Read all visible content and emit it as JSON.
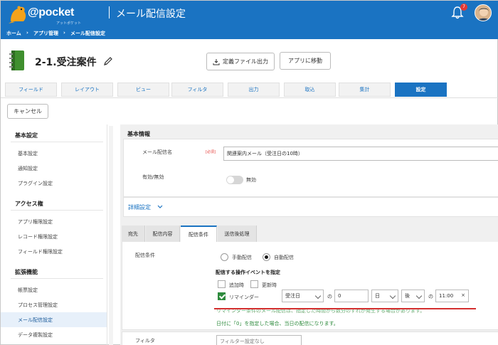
{
  "header": {
    "brand": "@pocket",
    "brand_sub": "アットポケット",
    "page_title": "メール配信設定",
    "notification_count": "7"
  },
  "breadcrumb": [
    "ホーム",
    "›",
    "アプリ管理",
    "›",
    "メール配信設定"
  ],
  "app": {
    "title": "2-1.受注案件",
    "export_button": "定義ファイル出力",
    "goto_app_button": "アプリに移動"
  },
  "tabs": [
    "フィールド",
    "レイアウト",
    "ビュー",
    "フィルタ",
    "出力",
    "取込",
    "集計",
    "設定"
  ],
  "active_tab": "設定",
  "cancel_button": "キャンセル",
  "sidebar": {
    "sections": [
      {
        "heading": "基本設定",
        "items": [
          "基本設定",
          "通知設定",
          "プラグイン設定"
        ]
      },
      {
        "heading": "アクセス権",
        "items": [
          "アプリ権限設定",
          "レコード権限設定",
          "フィールド権限設定"
        ]
      },
      {
        "heading": "拡張機能",
        "items": [
          "帳票設定",
          "プロセス管理設定",
          "メール配信設定",
          "データ複製設定"
        ]
      }
    ],
    "active_item": "メール配信設定"
  },
  "basic_info": {
    "heading": "基本情報",
    "name_label": "メール配信名",
    "required_badge": "[必須]",
    "name_value": "関連案内メール（受注日の10時）",
    "enabled_label": "有効/無効",
    "enabled_state": "無効"
  },
  "detail_settings_link": "詳細設定",
  "subtabs": [
    "宛先",
    "配信内容",
    "配信条件",
    "送信後処理"
  ],
  "active_subtab": "配信条件",
  "conditions": {
    "label": "配信条件",
    "manual_option": "手動配信",
    "auto_option": "自動配信",
    "selected": "自動配信",
    "event_heading": "配信する操作イベントを指定",
    "add_option": "追加時",
    "update_option": "更新時",
    "reminder_option": "リマインダー",
    "reminder_checked": true,
    "reminder_field": "受注日",
    "of_text": "の",
    "offset_value": "0",
    "unit": "日",
    "direction": "後",
    "of_text2": "の",
    "time": "11:00",
    "clear_symbol": "×",
    "note1": "リマインダー条件のメール配信は、指定した時間から数分のずれが発生する場合があります。",
    "note2": "日付に「0」を指定した場合、当日の配信になります。"
  },
  "filter": {
    "label": "フィルタ",
    "value": "フィルター設定なし"
  },
  "colors": {
    "brand_blue": "#1a73c2",
    "check_green": "#2e8b3d",
    "highlight_red": "#d32f2f"
  }
}
